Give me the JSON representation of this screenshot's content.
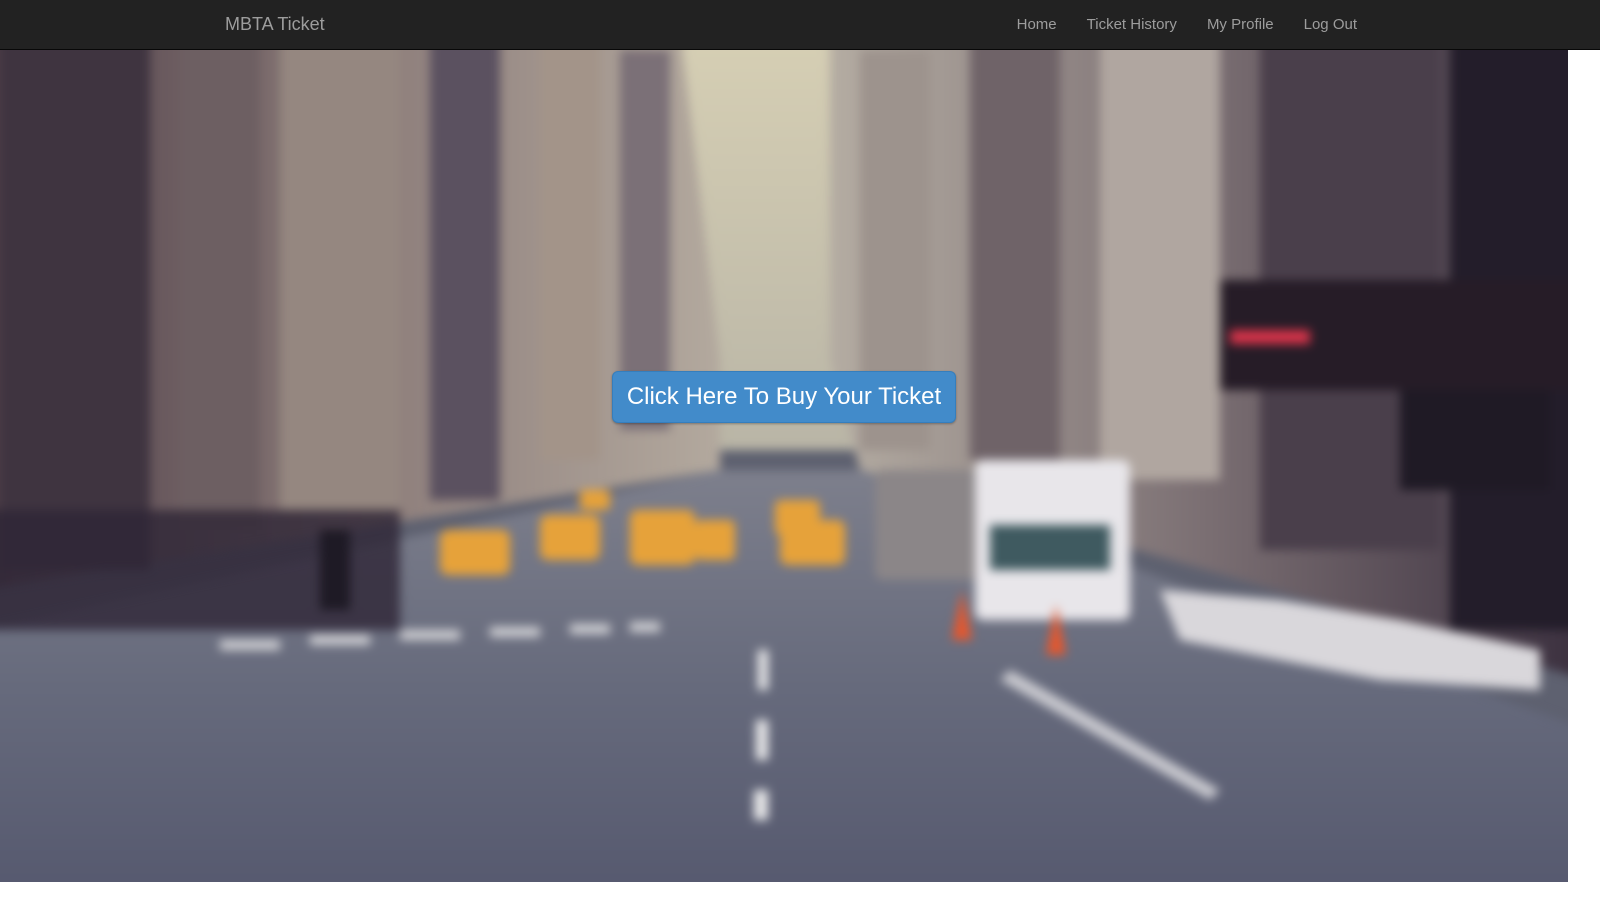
{
  "navbar": {
    "brand": "MBTA Ticket",
    "links": [
      {
        "label": "Home"
      },
      {
        "label": "Ticket History"
      },
      {
        "label": "My Profile"
      },
      {
        "label": "Log Out"
      }
    ]
  },
  "hero": {
    "buy_button_label": "Click Here To Buy Your Ticket",
    "background_description_icon": "city-street-photo"
  },
  "colors": {
    "navbar_bg": "#222222",
    "nav_text": "#9d9d9d",
    "button_bg": "#428bca",
    "button_text": "#ffffff"
  }
}
